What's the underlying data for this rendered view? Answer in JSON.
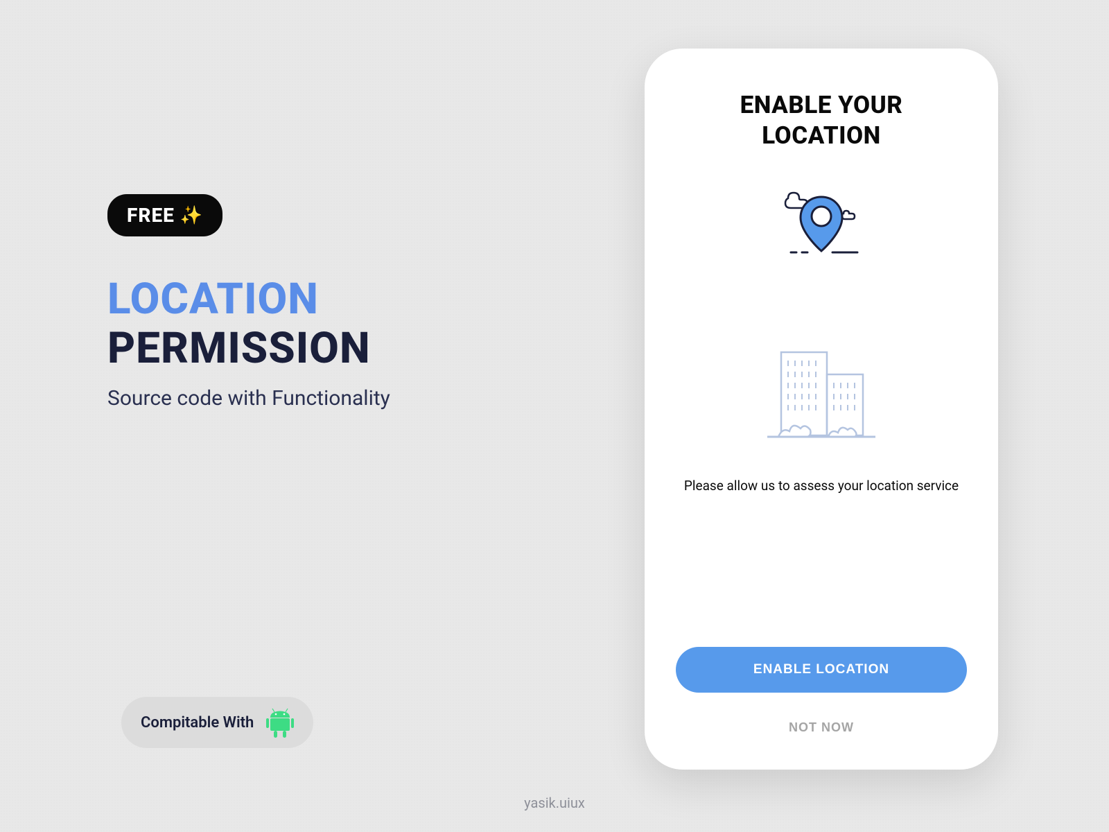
{
  "promo": {
    "badge": "FREE",
    "headline_line1": "LOCATION",
    "headline_line2": "PERMISSION",
    "subtitle": "Source code with Functionality",
    "compat_label": "Compitable With"
  },
  "phone": {
    "title_line1": "ENABLE YOUR",
    "title_line2": "LOCATION",
    "description": "Please allow us to assess your location service",
    "primary_button": "ENABLE LOCATION",
    "secondary_button": "NOT NOW"
  },
  "watermark": "yasik.uiux",
  "colors": {
    "accent_blue": "#5a8de8",
    "button_blue": "#579aeb",
    "dark": "#1a1f3a"
  }
}
